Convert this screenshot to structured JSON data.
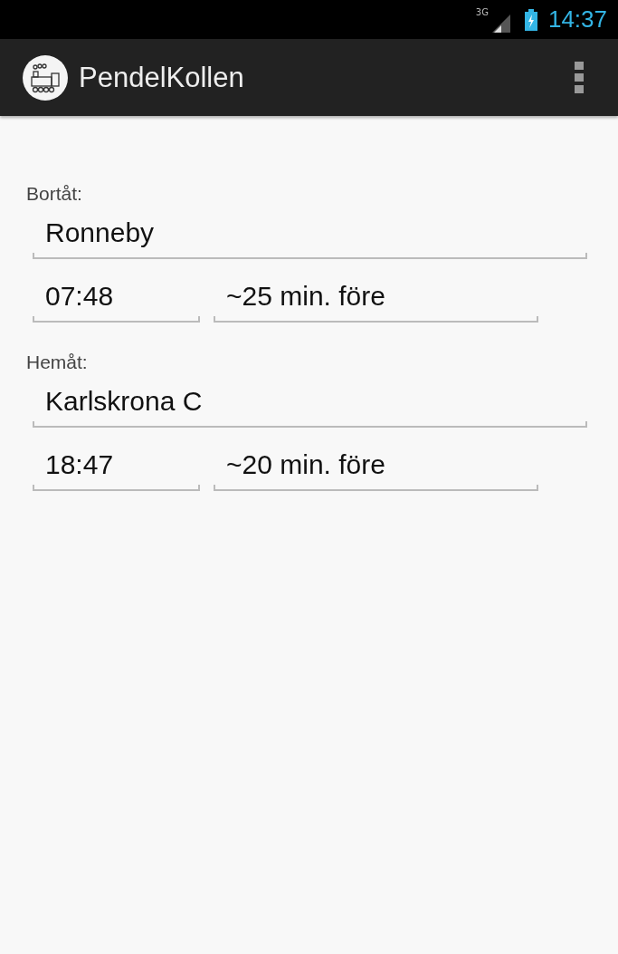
{
  "status_bar": {
    "network": "3G",
    "time": "14:37"
  },
  "action_bar": {
    "title": "PendelKollen"
  },
  "sections": [
    {
      "label": "Bortåt:",
      "station": "Ronneby",
      "time": "07:48",
      "offset": "~25 min. före"
    },
    {
      "label": "Hemåt:",
      "station": "Karlskrona C",
      "time": "18:47",
      "offset": "~20 min. före"
    }
  ]
}
